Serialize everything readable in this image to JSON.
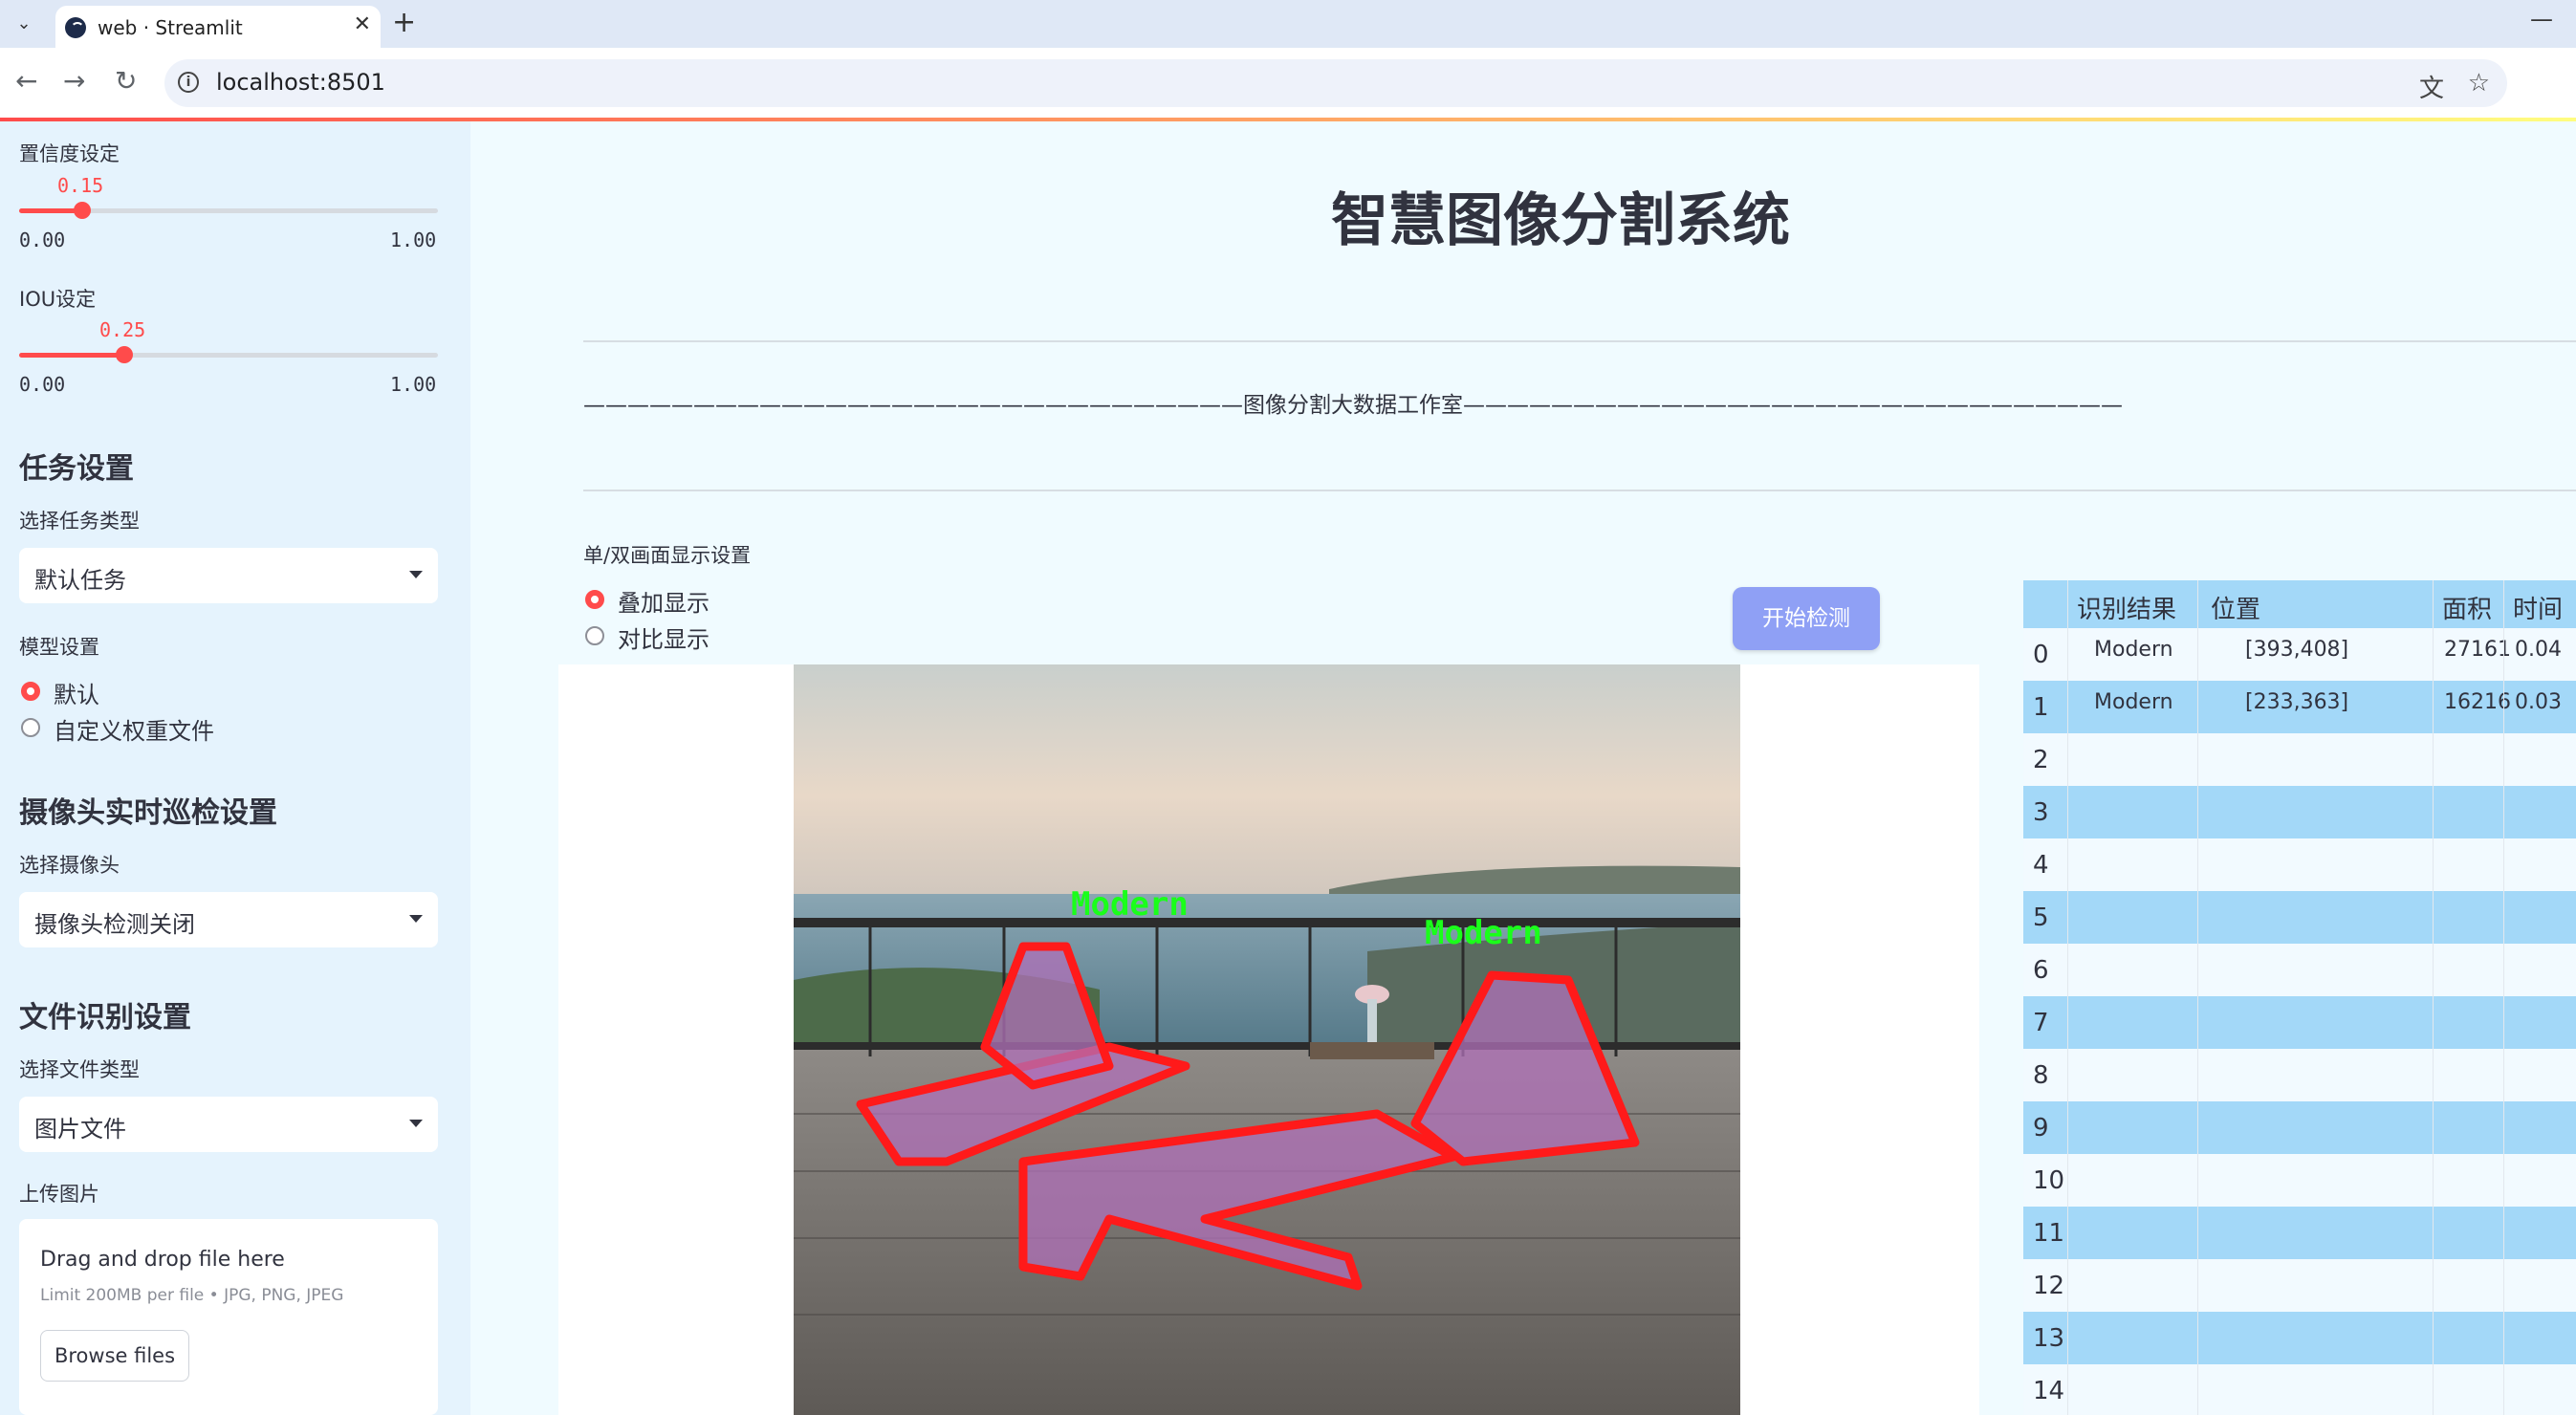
{
  "browser": {
    "tab_title": "web · Streamlit",
    "url": "localhost:8501"
  },
  "sidebar": {
    "confidence": {
      "label": "置信度设定",
      "value": "0.15",
      "min": "0.00",
      "max": "1.00",
      "fraction": 0.15
    },
    "iou": {
      "label": "IOU设定",
      "value": "0.25",
      "min": "0.00",
      "max": "1.00",
      "fraction": 0.25
    },
    "task_section": "任务设置",
    "task_type_label": "选择任务类型",
    "task_type_value": "默认任务",
    "model_label": "模型设置",
    "model_options": [
      "默认",
      "自定义权重文件"
    ],
    "model_selected": 0,
    "camera_section": "摄像头实时巡检设置",
    "camera_label": "选择摄像头",
    "camera_value": "摄像头检测关闭",
    "file_section": "文件识别设置",
    "file_type_label": "选择文件类型",
    "file_type_value": "图片文件",
    "upload_label": "上传图片",
    "upload_title": "Drag and drop file here",
    "upload_limit": "Limit 200MB per file • JPG, PNG, JPEG",
    "browse_button": "Browse files"
  },
  "main": {
    "title": "智慧图像分割系统",
    "banner": "——————————————————————————————图像分割大数据工作室——————————————————————————————",
    "display_label": "单/双画面显示设置",
    "display_options": [
      "叠加显示",
      "对比显示"
    ],
    "display_selected": 0,
    "start_button": "开始检测",
    "detection_labels": [
      "Modern",
      "Modern"
    ]
  },
  "table": {
    "columns": [
      "识别结果",
      "位置",
      "面积",
      "时间"
    ],
    "rows": [
      {
        "idx": "0",
        "result": "Modern",
        "position": "[393,408]",
        "area": "27161",
        "time": "0.04"
      },
      {
        "idx": "1",
        "result": "Modern",
        "position": "[233,363]",
        "area": "16216",
        "time": "0.03"
      },
      {
        "idx": "2",
        "result": "",
        "position": "",
        "area": "",
        "time": ""
      },
      {
        "idx": "3",
        "result": "",
        "position": "",
        "area": "",
        "time": ""
      },
      {
        "idx": "4",
        "result": "",
        "position": "",
        "area": "",
        "time": ""
      },
      {
        "idx": "5",
        "result": "",
        "position": "",
        "area": "",
        "time": ""
      },
      {
        "idx": "6",
        "result": "",
        "position": "",
        "area": "",
        "time": ""
      },
      {
        "idx": "7",
        "result": "",
        "position": "",
        "area": "",
        "time": ""
      },
      {
        "idx": "8",
        "result": "",
        "position": "",
        "area": "",
        "time": ""
      },
      {
        "idx": "9",
        "result": "",
        "position": "",
        "area": "",
        "time": ""
      },
      {
        "idx": "10",
        "result": "",
        "position": "",
        "area": "",
        "time": ""
      },
      {
        "idx": "11",
        "result": "",
        "position": "",
        "area": "",
        "time": ""
      },
      {
        "idx": "12",
        "result": "",
        "position": "",
        "area": "",
        "time": ""
      },
      {
        "idx": "13",
        "result": "",
        "position": "",
        "area": "",
        "time": ""
      },
      {
        "idx": "14",
        "result": "",
        "position": "",
        "area": "",
        "time": ""
      }
    ]
  },
  "colors": {
    "accent": "#ff4b4b",
    "sidebar_bg": "#e5f3fd",
    "table_band": "#a3d8f8",
    "button": "#8fa0f5"
  }
}
